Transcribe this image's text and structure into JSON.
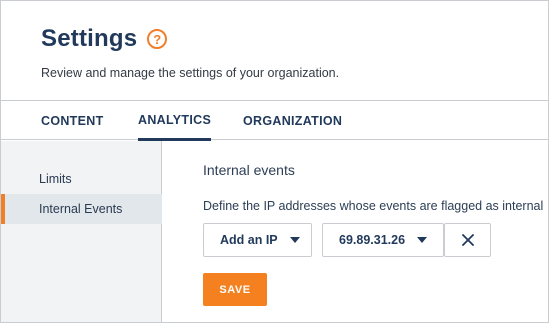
{
  "header": {
    "title": "Settings",
    "help_icon_glyph": "?",
    "subtitle": "Review and manage the settings of your organization."
  },
  "tabs": [
    {
      "label": "CONTENT",
      "active": false
    },
    {
      "label": "ANALYTICS",
      "active": true
    },
    {
      "label": "ORGANIZATION",
      "active": false
    }
  ],
  "sidebar": {
    "items": [
      {
        "label": "Limits",
        "selected": false
      },
      {
        "label": "Internal Events",
        "selected": true
      }
    ]
  },
  "main": {
    "section_title": "Internal events",
    "description": "Define the IP addresses whose events are flagged as internal",
    "add_ip_label": "Add an IP",
    "ip_value": "69.89.31.26",
    "save_label": "SAVE"
  },
  "colors": {
    "accent": "#f4801f",
    "primary_text": "#21395b",
    "sidebar_bg": "#f1f3f5",
    "border": "#c9cdd2"
  },
  "icons": [
    "help-icon",
    "chevron-down-icon",
    "close-icon"
  ]
}
